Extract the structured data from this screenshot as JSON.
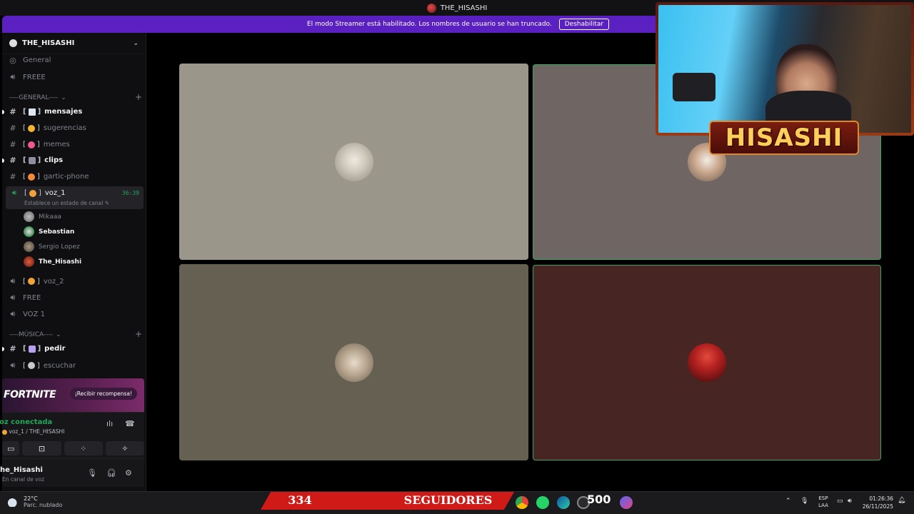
{
  "window": {
    "title": "THE_HISASHI"
  },
  "banner": {
    "message": "El modo Streamer está habilitado. Los nombres de usuario se han truncado.",
    "button": "Deshabilitar"
  },
  "server": {
    "name": "THE_HISASHI"
  },
  "top_channels": [
    {
      "name": "General",
      "icon": "server-guide-icon"
    },
    {
      "name": "FREEE",
      "icon": "speaker-icon"
    }
  ],
  "categories": {
    "general": "----GENERAL----",
    "music": "----MÚSICA----"
  },
  "text_channels": [
    {
      "name": "mensajes",
      "open": "[",
      "close": "]",
      "unread": true
    },
    {
      "name": "sugerencias",
      "open": "[",
      "close": "]",
      "unread": false
    },
    {
      "name": "memes",
      "open": "[",
      "close": "]",
      "unread": false
    },
    {
      "name": "clips",
      "open": "[",
      "close": "]",
      "unread": true
    },
    {
      "name": "gartic-phone",
      "open": "[",
      "close": "]",
      "unread": false
    }
  ],
  "active_voice": {
    "name": "voz_1",
    "open": "[",
    "close": "]",
    "timer": "36:39",
    "status": "Establece un estado de canal"
  },
  "members": [
    {
      "name": "Mikaaa",
      "highlight": false
    },
    {
      "name": "Sebastian",
      "highlight": true
    },
    {
      "name": "Sergio Lopez",
      "highlight": false
    },
    {
      "name": "The_Hisashi",
      "highlight": true
    }
  ],
  "voice_channels": [
    {
      "name": "voz_2",
      "open": "[",
      "close": "]"
    },
    {
      "name": "FREE"
    },
    {
      "name": "VOZ 1"
    }
  ],
  "music_channels": [
    {
      "name": "pedir",
      "open": "[",
      "close": "]",
      "unread": true
    },
    {
      "name": "escuchar",
      "open": "[",
      "close": "]",
      "unread": false
    }
  ],
  "promo": {
    "brand": "FORTNITE",
    "cta": "¡Recibir recompensa!"
  },
  "voice_status": {
    "title": "oz conectada",
    "location": "voz_1 / THE_HISASHI"
  },
  "user": {
    "name": "he_Hisashi",
    "status": "En canal de voz"
  },
  "overlay": {
    "name": "HISASHI"
  },
  "colors": {
    "accent": "#5b20c0",
    "online": "#23a55a",
    "overlay_text": "#ffcf5a",
    "followers_bg": "#cf1a18"
  },
  "taskbar": {
    "temperature": "22°C",
    "condition": "Parc. nublado",
    "followers_count": "334",
    "followers_label": "SEGUIDORES",
    "badge": "500",
    "lang_1": "ESP",
    "lang_2": "LAA",
    "time": "01:26:36",
    "date": "26/11/2025"
  }
}
